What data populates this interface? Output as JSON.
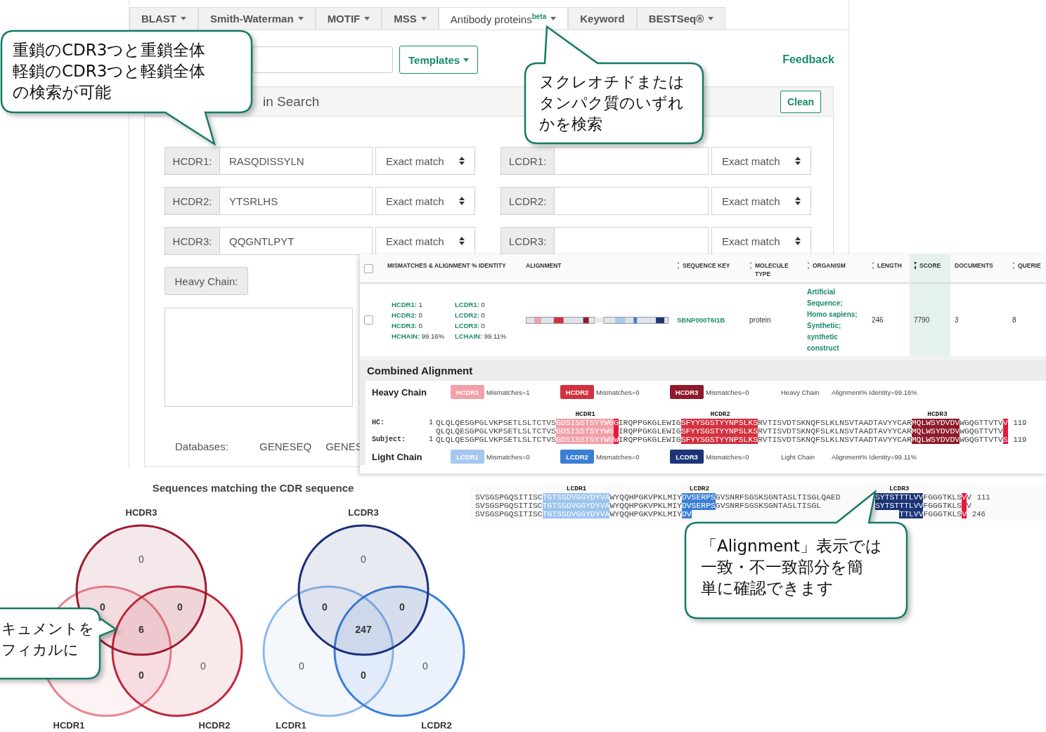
{
  "tabs": [
    {
      "label": "BLAST",
      "dropdown": true,
      "selected": false
    },
    {
      "label": "Smith-Waterman",
      "dropdown": true,
      "selected": false
    },
    {
      "label": "MOTIF",
      "dropdown": true,
      "selected": false
    },
    {
      "label": "MSS",
      "dropdown": true,
      "selected": false
    },
    {
      "label": "Antibody proteins$^{beta}$",
      "dropdown": true,
      "selected": true
    },
    {
      "label": "Keyword",
      "dropdown": false,
      "selected": false
    },
    {
      "label": "BESTSeq®",
      "dropdown": true,
      "selected": false
    }
  ],
  "toolbar": {
    "templates_button": "Templates",
    "feedback_link": "Feedback"
  },
  "search_panel": {
    "title": "in Search",
    "clean_button": "Clean",
    "heavy_fields": [
      {
        "label": "HCDR1:",
        "value": "RASQDISSYLN",
        "match": "Exact match"
      },
      {
        "label": "HCDR2:",
        "value": "YTSRLHS",
        "match": "Exact match"
      },
      {
        "label": "HCDR3:",
        "value": "QQGNTLPYT",
        "match": "Exact match"
      }
    ],
    "light_fields": [
      {
        "label": "LCDR1:",
        "match": "Exact match"
      },
      {
        "label": "LCDR2:",
        "match": "Exact match"
      },
      {
        "label": "LCDR3:",
        "match": "Exact match"
      }
    ],
    "heavy_chain_button": "Heavy Chain:",
    "databases_label": "Databases:",
    "databases": [
      "GENESEQ",
      "GENES"
    ]
  },
  "results": {
    "all_selected": false,
    "columns": [
      {
        "label": "MISMATCHES & ALIGNMENT % IDENTITY",
        "sortable": false,
        "sorted": false
      },
      {
        "label": "ALIGNMENT",
        "sortable": false,
        "sorted": false
      },
      {
        "label": "SEQUENCE KEY",
        "sortable": true,
        "sorted": false
      },
      {
        "label": "MOLECULE TYPE",
        "sortable": true,
        "sorted": false
      },
      {
        "label": "ORGANISM",
        "sortable": true,
        "sorted": false
      },
      {
        "label": "LENGTH",
        "sortable": true,
        "sorted": false
      },
      {
        "label": "SCORE",
        "sortable": true,
        "sorted": true
      },
      {
        "label": "DOCUMENTS",
        "sortable": false,
        "sorted": false
      },
      {
        "label": "QUERIE",
        "sortable": true,
        "sorted": false
      }
    ],
    "rows": [
      {
        "selected": false,
        "mismatches": [
          {
            "label": "HCDR1:",
            "value": "1"
          },
          {
            "label": "LCDR1:",
            "value": "0"
          },
          {
            "label": "HCDR2:",
            "value": "0"
          },
          {
            "label": "LCDR2:",
            "value": "0"
          },
          {
            "label": "HCDR3:",
            "value": "0"
          },
          {
            "label": "LCDR3:",
            "value": "0"
          },
          {
            "label": "HCHAIN:",
            "value": "99.16%"
          },
          {
            "label": "LCHAIN:",
            "value": "99.11%"
          }
        ],
        "sequence_key": "SBNP000T6I1B",
        "molecule_type": "protein",
        "organism": "Artificial Sequence; Homo sapiens; Synthetic; synthetic construct",
        "length": "246",
        "score": "7790",
        "documents": "3",
        "queries": "8"
      }
    ]
  },
  "alignment": {
    "title": "Combined Alignment",
    "heavy": {
      "title": "Heavy Chain",
      "identity_label": "Heavy Chain",
      "identity": "Alignment% Identity=99.16%",
      "badges": [
        {
          "label": "HCDR1",
          "color": "#f2a0a8",
          "mismatches": "Mismatches=1"
        },
        {
          "label": "HCDR2",
          "color": "#d3313f",
          "mismatches": "Mismatches=0"
        },
        {
          "label": "HCDR3",
          "color": "#8e1b2b",
          "mismatches": "Mismatches=0"
        }
      ],
      "cdr_labels": [
        "HCDR1",
        "HCDR2",
        "HCDR3"
      ],
      "rows": [
        {
          "label": "HC:",
          "start": "1",
          "end": "119",
          "segments": [
            {
              "kind": "plain",
              "text": "QLQLQESGPGLVKPSETLSLTCTVS"
            },
            {
              "kind": "cdr1",
              "text": "GDSISSTSYYWG"
            },
            {
              "kind": "mismatch",
              "text": "G"
            },
            {
              "kind": "plain",
              "text": "IRQPPGKGLEWIG"
            },
            {
              "kind": "cdr2",
              "text": "SFYYSGSTYYNPSLKS"
            },
            {
              "kind": "plain",
              "text": "RVTISVDTSKNQFSLKLNSVTAADTAVYYCAR"
            },
            {
              "kind": "cdr3",
              "text": "MQLWSYDVDV"
            },
            {
              "kind": "plain",
              "text": "WGQGTTVTV"
            },
            {
              "kind": "mismatch",
              "text": "V"
            }
          ]
        },
        {
          "segments": [
            {
              "kind": "plain",
              "text": "QLQLQESGPGLVKPSETLSLTCTVS"
            },
            {
              "kind": "cdr1",
              "text": "GDSISSTSYYWG"
            },
            {
              "kind": "gap"
            },
            {
              "kind": "plain",
              "text": "IRQPPGKGLEWIG"
            },
            {
              "kind": "cdr2",
              "text": "SFYYSGSTYYNPSLKS"
            },
            {
              "kind": "plain",
              "text": "RVTISVDTSKNQFSLKLNSVTAADTAVYYCAR"
            },
            {
              "kind": "cdr3",
              "text": "MQLWSYDVDV"
            },
            {
              "kind": "plain",
              "text": "WGQGTTVTV"
            },
            {
              "kind": "gap"
            }
          ]
        },
        {
          "label": "Subject:",
          "start": "1",
          "end": "119",
          "segments": [
            {
              "kind": "plain",
              "text": "QLQLQESGPGLVKPSETLSLTCTVS"
            },
            {
              "kind": "cdr1",
              "text": "GDSISSTSYYWG"
            },
            {
              "kind": "mismatch",
              "text": "W"
            },
            {
              "kind": "plain",
              "text": "IRQPPGKGLEWIG"
            },
            {
              "kind": "cdr2",
              "text": "SFYYSGSTYYNPSLKS"
            },
            {
              "kind": "plain",
              "text": "RVTISVDTSKNQFSLKLNSVTAADTAVYYCAR"
            },
            {
              "kind": "cdr3",
              "text": "MQLWSYDVDV"
            },
            {
              "kind": "plain",
              "text": "WGQGTTVTV"
            },
            {
              "kind": "mismatch",
              "text": "S"
            }
          ]
        }
      ]
    },
    "light": {
      "title": "Light Chain",
      "identity_label": "Light Chain",
      "identity": "Alignment% Identity=99.11%",
      "badges": [
        {
          "label": "LCDR1",
          "color": "#a5c8f0",
          "mismatches": "Mismatches=0"
        },
        {
          "label": "LCDR2",
          "color": "#3b7fd4",
          "mismatches": "Mismatches=0"
        },
        {
          "label": "LCDR3",
          "color": "#1d3477",
          "mismatches": "Mismatches=0"
        }
      ],
      "cdr_labels": [
        "LCDR1",
        "LCDR2",
        "LCDR3"
      ],
      "rows": [
        {
          "end": "111",
          "left": [
            {
              "kind": "plain",
              "text": "SVSGSPGQSITISC"
            },
            {
              "kind": "cdr1",
              "text": "TGTSSDVGGYDYVA"
            },
            {
              "kind": "plain",
              "text": "WYQQHPGKVPKLMIY"
            },
            {
              "kind": "cdr2",
              "text": "DVSERPS"
            },
            {
              "kind": "plain",
              "text": "GVSNRFSGSKSGNTASLTISGLQAED"
            }
          ],
          "right": [
            {
              "kind": "cdr3",
              "text": "SYTSTTTLVV"
            },
            {
              "kind": "plain",
              "text": "FGGGTKLS"
            },
            {
              "kind": "mismatch",
              "text": "V"
            },
            {
              "kind": "plain",
              "text": "V"
            }
          ]
        },
        {
          "left": [
            {
              "kind": "plain",
              "text": "SVSGSPGQSITISC"
            },
            {
              "kind": "cdr1",
              "text": "TGTSSDVGGYDYVA"
            },
            {
              "kind": "plain",
              "text": "WYQQHPGKVPKLMIY"
            },
            {
              "kind": "cdr2",
              "text": "DVSERPS"
            },
            {
              "kind": "plain",
              "text": "GVSNRFSGSKSGNTASLTISGL"
            }
          ],
          "right": [
            {
              "kind": "cdr3",
              "text": "SYTSTTTLVV"
            },
            {
              "kind": "plain",
              "text": "FGGGTKLS"
            },
            {
              "kind": "gap"
            },
            {
              "kind": "plain",
              "text": "V"
            }
          ]
        },
        {
          "end": "246",
          "left": [
            {
              "kind": "plain",
              "text": "SVSGSPGQSITISC"
            },
            {
              "kind": "cdr1",
              "text": "TGTSSDVGGYDYVA"
            },
            {
              "kind": "plain",
              "text": "WYQQHPGKVPKLMIY"
            },
            {
              "kind": "cdr2",
              "text": "DV"
            }
          ],
          "right": [
            {
              "kind": "cdr3",
              "text": "TTLVV"
            },
            {
              "kind": "plain",
              "text": "FGGGTKLS"
            },
            {
              "kind": "mismatch",
              "text": "V"
            }
          ]
        }
      ]
    }
  },
  "venn": {
    "title": "Sequences matching the CDR sequence",
    "diagrams": [
      {
        "sets": [
          {
            "label": "HCDR1",
            "color": "#e8848f"
          },
          {
            "label": "HCDR2",
            "color": "#c0283c"
          },
          {
            "label": "HCDR3",
            "color": "#9b1b30"
          }
        ],
        "regions": [
          {
            "kind": "c",
            "value": "0"
          },
          {
            "kind": "ac",
            "value": "0"
          },
          {
            "kind": "bc",
            "value": "0"
          },
          {
            "kind": "abc",
            "value": "6"
          },
          {
            "kind": "b",
            "value": "0"
          },
          {
            "kind": "ab",
            "value": "0"
          }
        ]
      },
      {
        "sets": [
          {
            "label": "LCDR1",
            "color": "#8fb8ec"
          },
          {
            "label": "LCDR2",
            "color": "#3a7fd6"
          },
          {
            "label": "LCDR3",
            "color": "#1a2f7a"
          }
        ],
        "regions": [
          {
            "kind": "c",
            "value": "0"
          },
          {
            "kind": "ac",
            "value": "0"
          },
          {
            "kind": "bc",
            "value": "0"
          },
          {
            "kind": "abc",
            "value": "247"
          },
          {
            "kind": "a",
            "value": "0"
          },
          {
            "kind": "b",
            "value": "0"
          },
          {
            "kind": "ab",
            "value": "0"
          }
        ]
      }
    ]
  },
  "callouts": [
    {
      "lines": [
        "重鎖のCDR3つと重鎖全体",
        "軽鎖のCDR3つと軽鎖全体",
        "の検索が可能"
      ]
    },
    {
      "lines": [
        "ヌクレオチドまたは",
        "タンパク質のいずれ",
        "かを検索"
      ]
    },
    {
      "lines": [
        "「Alignment」表示では",
        "一致・不一致部分を簡",
        "単に確認できます"
      ]
    },
    {
      "lines": [
        "キュメントを",
        "フィカルに"
      ]
    }
  ]
}
